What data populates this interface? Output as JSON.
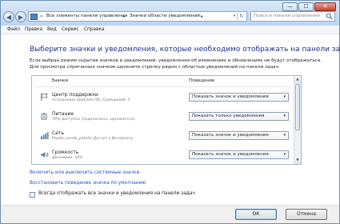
{
  "window": {
    "controls": {
      "minimize": "—",
      "maximize": "☐",
      "close": "✕"
    }
  },
  "nav": {
    "back": "◀",
    "forward": "▶"
  },
  "address": {
    "sep1": "»",
    "crumb1": "Все элементы панели управления",
    "sep2": "▸",
    "crumb2": "Значки области уведомлений",
    "sep3": "▸",
    "dropdown": "▾",
    "refresh": "↻"
  },
  "search": {
    "placeholder": "Поиск в панели управления"
  },
  "menu": [
    "Файл",
    "Правка",
    "Вид",
    "Сервис",
    "Справка"
  ],
  "content": {
    "heading": "Выберите значки и уведомления, которые необходимо отображать на панели задач",
    "desc1": "Если выбран режим скрытия значков и уведомлений, уведомления об изменениях и обновлениях не будут отображаться.",
    "desc2": "Для просмотра спрятанных значков щелкните стрелку рядом с областью уведомлений на панели задач."
  },
  "table": {
    "col_icons": "Значки",
    "col_behavior": "Поведение",
    "rows": [
      {
        "name": "Центр поддержки",
        "sub": "Устранение проблем ПК: Сообщений: 3",
        "behavior": "Показать значок и уведомления",
        "icon": "flag-icon"
      },
      {
        "name": "Питание",
        "sub": "79% доступно (подключена, заряжается)",
        "behavior": "Показать только уведомления",
        "icon": "battery-icon"
      },
      {
        "name": "Сеть",
        "sub": "Pepito_vende_pidrillo Доступ к Интернету",
        "behavior": "Показать значок и уведомления",
        "icon": "network-icon"
      },
      {
        "name": "Громкость",
        "sub": "Динамики: 30%",
        "behavior": "Показать значок и уведомления",
        "icon": "speaker-icon"
      }
    ],
    "select_arrow": "▾",
    "scroll_up": "▲",
    "scroll_down": "▼"
  },
  "links": {
    "system_icons": "Включить или выключить системные значки",
    "restore": "Восстановить поведение значка по умолчанию"
  },
  "checkbox": {
    "label": "Всегда отображать все значки и уведомления на панели задач",
    "checked": false
  },
  "buttons": {
    "ok": "ОК",
    "cancel": "Отмена"
  }
}
